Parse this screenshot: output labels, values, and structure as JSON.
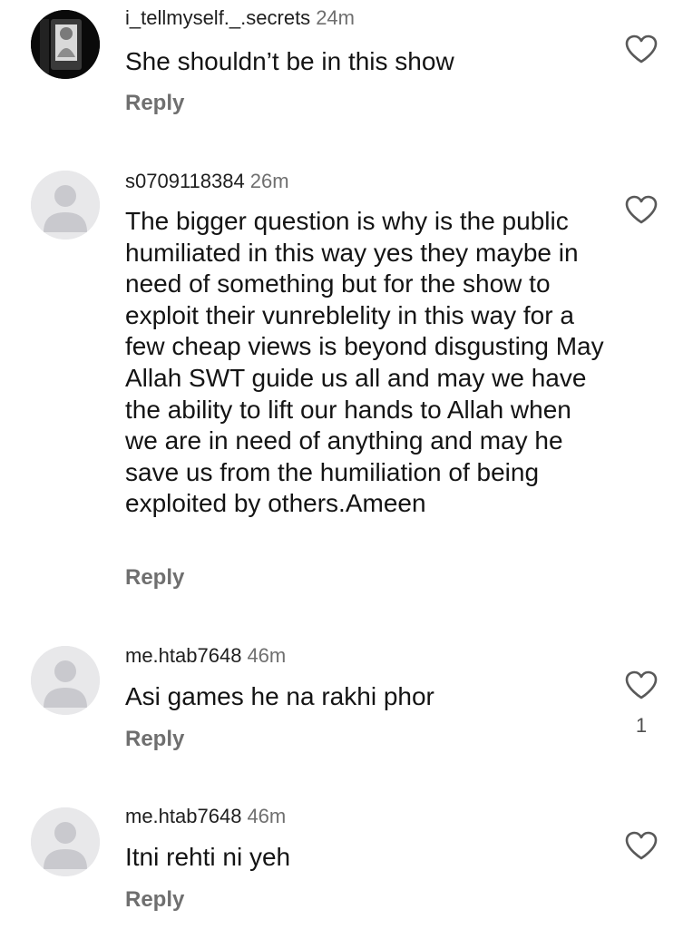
{
  "comments": [
    {
      "username": "i_tellmyself._.secrets",
      "time": "24m",
      "text": "She shouldn’t be in this show",
      "reply_label": "Reply",
      "avatar": "photo-avatar",
      "like_icon": "heart-outline-icon"
    },
    {
      "username": "s0709118384",
      "time": "26m",
      "text": "The bigger question is why is the public humiliated in this way yes they maybe in need of something but for the show to exploit their vunreblelity in this way for a few cheap views is beyond disgusting May Allah SWT guide us all and may we have the ability to lift our hands to Allah when we are in need of anything and may he save us from the humiliation of being exploited by others.Ameen",
      "reply_label": "Reply",
      "avatar": "default-user-avatar",
      "like_icon": "heart-outline-icon"
    },
    {
      "username": "me.htab7648",
      "time": "46m",
      "text": "Asi games he na rakhi phor",
      "reply_label": "Reply",
      "avatar": "default-user-avatar",
      "like_icon": "heart-outline-icon",
      "like_count": "1"
    },
    {
      "username": "me.htab7648",
      "time": "46m",
      "text": "Itni rehti ni yeh",
      "reply_label": "Reply",
      "avatar": "default-user-avatar",
      "like_icon": "heart-outline-icon"
    }
  ],
  "colors": {
    "text": "#141414",
    "secondary": "#6f6f6f",
    "avatar_bg": "#e8e8ea",
    "avatar_fg": "#cbcbd0"
  }
}
